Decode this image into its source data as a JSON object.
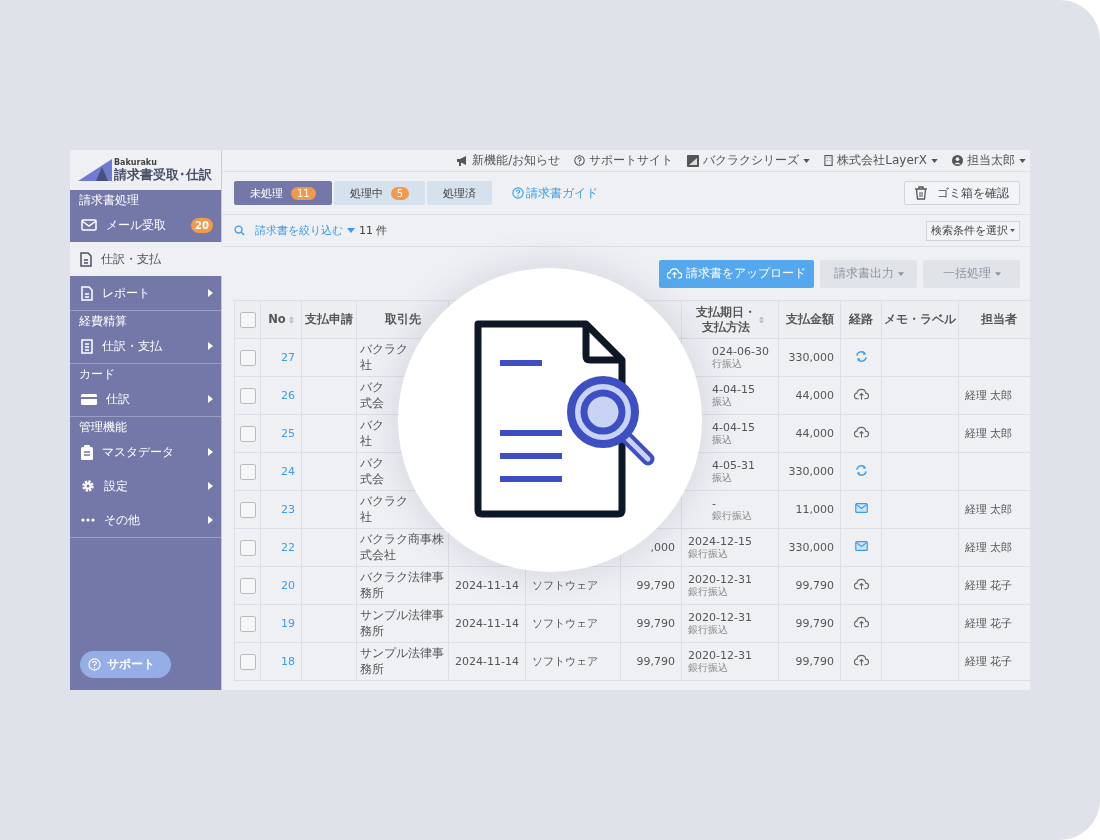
{
  "brand": {
    "small": "Bakuraku",
    "title": "請求書受取･仕訳"
  },
  "sidebar": [
    {
      "header": "請求書処理",
      "items": [
        {
          "kind": "mail",
          "label": "メール受取",
          "badge": "20",
          "selected": false,
          "arrow": false
        },
        {
          "kind": "doc",
          "label": "仕訳・支払",
          "selected": true,
          "arrow": false
        },
        {
          "kind": "doc",
          "label": "レポート",
          "selected": false,
          "arrow": true
        }
      ]
    },
    {
      "header": "経費精算",
      "items": [
        {
          "kind": "receipt",
          "label": "仕訳・支払",
          "selected": false,
          "arrow": true
        }
      ]
    },
    {
      "header": "カード",
      "items": [
        {
          "kind": "card",
          "label": "仕訳",
          "selected": false,
          "arrow": true
        }
      ]
    },
    {
      "header": "管理機能",
      "items": [
        {
          "kind": "clipboard",
          "label": "マスタデータ",
          "selected": false,
          "arrow": true
        },
        {
          "kind": "gear",
          "label": "設定",
          "selected": false,
          "arrow": true
        },
        {
          "kind": "dots",
          "label": "その他",
          "selected": false,
          "arrow": true
        }
      ]
    }
  ],
  "support_button": "サポート",
  "top_bar": [
    {
      "kind": "megaphone",
      "label": "新機能/お知らせ",
      "caret": false
    },
    {
      "kind": "help",
      "label": "サポートサイト",
      "caret": false
    },
    {
      "kind": "image",
      "label": "バクラクシリーズ",
      "caret": true
    },
    {
      "kind": "building",
      "label": "株式会社LayerX",
      "caret": true
    },
    {
      "kind": "user",
      "label": "担当太郎",
      "caret": true
    }
  ],
  "tabs": [
    {
      "label": "未処理",
      "count": "11",
      "selected": true
    },
    {
      "label": "処理中",
      "count": "5",
      "selected": false
    },
    {
      "label": "処理済",
      "selected": false
    }
  ],
  "guide_link": "請求書ガイド",
  "trash_button": "ゴミ箱を確認",
  "filter": {
    "label": "請求書を絞り込む",
    "count": "11 件",
    "conditions_button": "検索条件を選択"
  },
  "actions": [
    {
      "label": "請求書をアップロード",
      "kind": "primary",
      "disabled": false
    },
    {
      "label": "請求書出力",
      "kind": "menu",
      "disabled": true
    },
    {
      "label": "一括処理",
      "kind": "menu",
      "disabled": true
    }
  ],
  "table": {
    "select_all_checked": false,
    "columns": [
      {
        "label": "No",
        "sortable": true
      },
      {
        "label": "支払申請",
        "sortable": false
      },
      {
        "label": "取引先",
        "sortable": false
      },
      {
        "label": "支払期日・支払方法",
        "sortable": true
      },
      {
        "label": "支払金額",
        "sortable": false
      },
      {
        "label": "経路",
        "sortable": false
      },
      {
        "label": "メモ・ラベル",
        "sortable": false
      },
      {
        "label": "担当者",
        "sortable": false
      }
    ],
    "rows": [
      {
        "no": "27",
        "vendor": [
          "バクラク",
          "社"
        ],
        "due": "024-06-30",
        "method": "行振込",
        "total": "330,000",
        "kind": "sync",
        "checked": false
      },
      {
        "no": "26",
        "vendor": [
          "バク",
          "式会"
        ],
        "due": "4-04-15",
        "method": "振込",
        "total": "44,000",
        "kind": "upload",
        "assignee": "経理 太郎",
        "checked": false
      },
      {
        "no": "25",
        "vendor": [
          "バク",
          "社"
        ],
        "due": "4-04-15",
        "method": "振込",
        "total": "44,000",
        "kind": "upload",
        "assignee": "経理 太郎",
        "checked": false
      },
      {
        "no": "24",
        "vendor": [
          "バク",
          "式会"
        ],
        "due": "4-05-31",
        "method": "振込",
        "total": "330,000",
        "kind": "sync",
        "checked": false
      },
      {
        "no": "23",
        "vendor": [
          "バクラク",
          "社"
        ],
        "due": "-",
        "method": "銀行振込",
        "total": "11,000",
        "kind": "mail",
        "assignee": "経理 太郎",
        "checked": false
      },
      {
        "no": "22",
        "vendor": [
          "バクラク商事株",
          "式会社"
        ],
        "amount": ",000",
        "due": "2024-12-15",
        "method": "銀行振込",
        "total": "330,000",
        "kind": "mail",
        "assignee": "経理 太郎",
        "checked": false
      },
      {
        "no": "20",
        "vendor": [
          "バクラク法律事",
          "務所"
        ],
        "date": "2024-11-14",
        "category": "ソフトウェア",
        "amount": "99,790",
        "due": "2020-12-31",
        "method": "銀行振込",
        "total": "99,790",
        "kind": "upload",
        "assignee": "経理 花子",
        "checked": false
      },
      {
        "no": "19",
        "vendor": [
          "サンプル法律事",
          "務所"
        ],
        "date": "2024-11-14",
        "category": "ソフトウェア",
        "amount": "99,790",
        "due": "2020-12-31",
        "method": "銀行振込",
        "total": "99,790",
        "kind": "upload",
        "assignee": "経理 花子",
        "checked": false
      },
      {
        "no": "18",
        "vendor": [
          "サンプル法律事",
          "務所"
        ],
        "date": "2024-11-14",
        "category": "ソフトウェア",
        "amount": "99,790",
        "due": "2020-12-31",
        "method": "銀行振込",
        "total": "99,790",
        "kind": "upload",
        "assignee": "経理 花子",
        "checked": false
      }
    ]
  }
}
